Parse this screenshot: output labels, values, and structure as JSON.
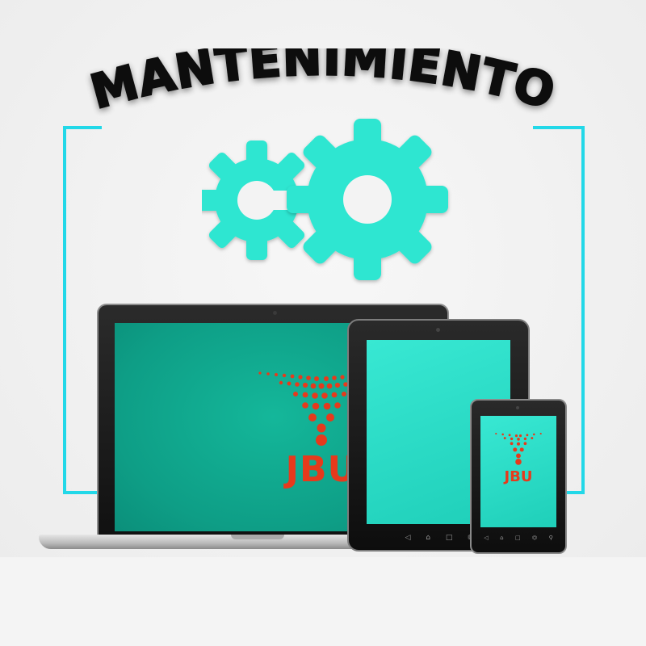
{
  "title": "MANTENIMIENTO",
  "logo": {
    "text": "JBU",
    "color": "#e63a1c"
  },
  "colors": {
    "accent": "#2ee6d1",
    "frame": "#22d8e8",
    "background": "#f1f1f1"
  },
  "icons": [
    "gears-icon",
    "laptop-icon",
    "tablet-icon",
    "phone-icon",
    "jbu-logo"
  ],
  "nav_icons": [
    "◁",
    "⌂",
    "□",
    "⏣",
    "⚲"
  ]
}
